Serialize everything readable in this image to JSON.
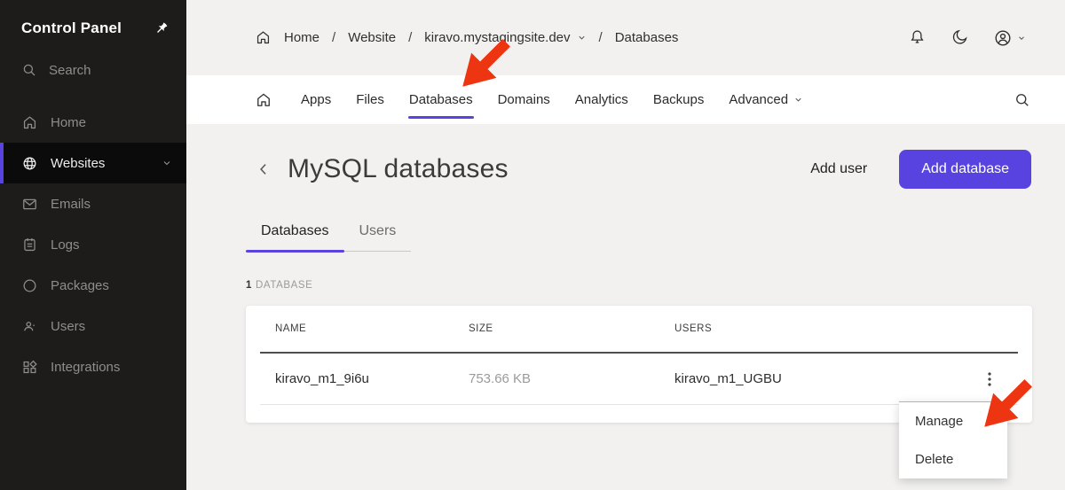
{
  "sidebar": {
    "title": "Control Panel",
    "search": "Search",
    "items": [
      {
        "label": "Home",
        "icon": "home-icon"
      },
      {
        "label": "Websites",
        "icon": "globe-icon",
        "active": true
      },
      {
        "label": "Emails",
        "icon": "envelope-icon"
      },
      {
        "label": "Logs",
        "icon": "journal-icon"
      },
      {
        "label": "Packages",
        "icon": "circle-icon"
      },
      {
        "label": "Users",
        "icon": "person-icon"
      },
      {
        "label": "Integrations",
        "icon": "grid-icon"
      }
    ]
  },
  "topbar": {
    "breadcrumbs": [
      "Home",
      "Website",
      "kiravo.mystagingsite.dev",
      "Databases"
    ]
  },
  "nav": {
    "items": [
      "Apps",
      "Files",
      "Databases",
      "Domains",
      "Analytics",
      "Backups",
      "Advanced"
    ],
    "active": "Databases"
  },
  "page": {
    "title": "MySQL databases",
    "add_user": "Add user",
    "add_database": "Add database"
  },
  "tabs": {
    "databases": "Databases",
    "users": "Users"
  },
  "count": {
    "value": "1",
    "label": "DATABASE"
  },
  "table": {
    "headers": [
      "NAME",
      "SIZE",
      "USERS"
    ],
    "rows": [
      {
        "name": "kiravo_m1_9i6u",
        "size": "753.66 KB",
        "users": "kiravo_m1_UGBU"
      }
    ]
  },
  "context_menu": {
    "items": [
      "Manage",
      "Delete"
    ]
  },
  "colors": {
    "accent": "#5843e1",
    "annotation_arrow": "#ee3512",
    "sidebar_bg": "#1d1c1b",
    "sidebar_active_bg": "#0b0b0b"
  }
}
